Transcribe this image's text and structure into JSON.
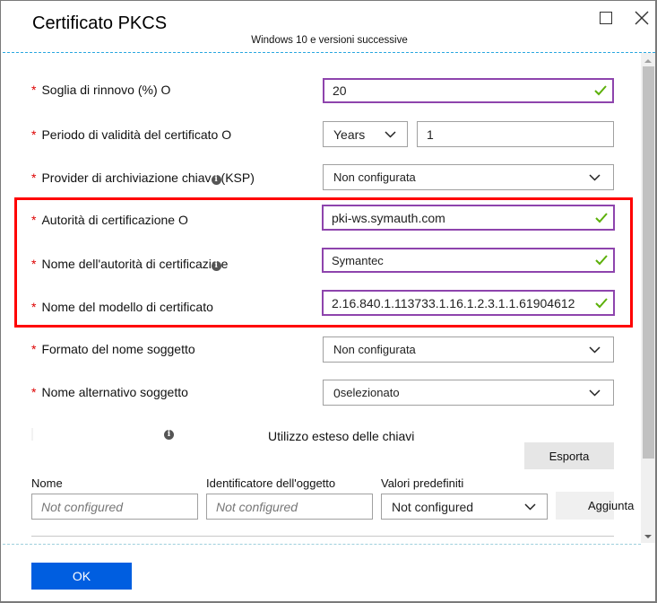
{
  "window": {
    "title": "Certificato PKCS",
    "subtitle": "Windows 10 e versioni successive",
    "maximize_icon": "maximize-icon",
    "close_icon": "close-icon"
  },
  "form": {
    "renewal_threshold": {
      "label": "Soglia di rinnovo (%) O",
      "value": "20",
      "valid": true
    },
    "validity_period": {
      "label": "Periodo di validità del certificato O",
      "unit": "Years",
      "value": "1"
    },
    "ksp": {
      "label_before": "Provider di archiviazione chiav",
      "label_after": "(KSP)",
      "value": "Non configurata"
    },
    "cert_authority": {
      "label": "Autorità di certificazione O",
      "value": "pki-ws.symauth.com",
      "valid": true
    },
    "cert_authority_name": {
      "label_before": "Nome dell'autorità di certificazio",
      "label_after": "e",
      "value": "Symantec",
      "valid": true
    },
    "template_name": {
      "label": "Nome del modello di certificato",
      "value": "2.16.840.1.113733.1.16.1.2.3.1.1.61904612",
      "valid": true
    },
    "subject_name_format": {
      "label": "Formato del nome soggetto",
      "value": "Non configurata"
    },
    "subject_alt_name": {
      "label": "Nome alternativo soggetto",
      "value_num": "0",
      "value_text": " selezionato"
    }
  },
  "eku": {
    "title": "Utilizzo esteso delle chiavi",
    "export_label": "Esporta",
    "columns": {
      "name": {
        "label": "Nome",
        "placeholder": "Not configured"
      },
      "oid": {
        "label": "Identificatore dell'oggetto",
        "placeholder": "Not configured"
      },
      "predefined": {
        "label": "Valori predefiniti",
        "value": "Not configured"
      }
    },
    "add_label": "Aggiunta"
  },
  "footer": {
    "ok_label": "OK"
  },
  "colors": {
    "accent": "#005ee0",
    "valid_border": "#8e44ad",
    "check": "#5cb00a",
    "highlight": "#ff0000",
    "required": "#dd0000"
  },
  "info_glyph": "i"
}
